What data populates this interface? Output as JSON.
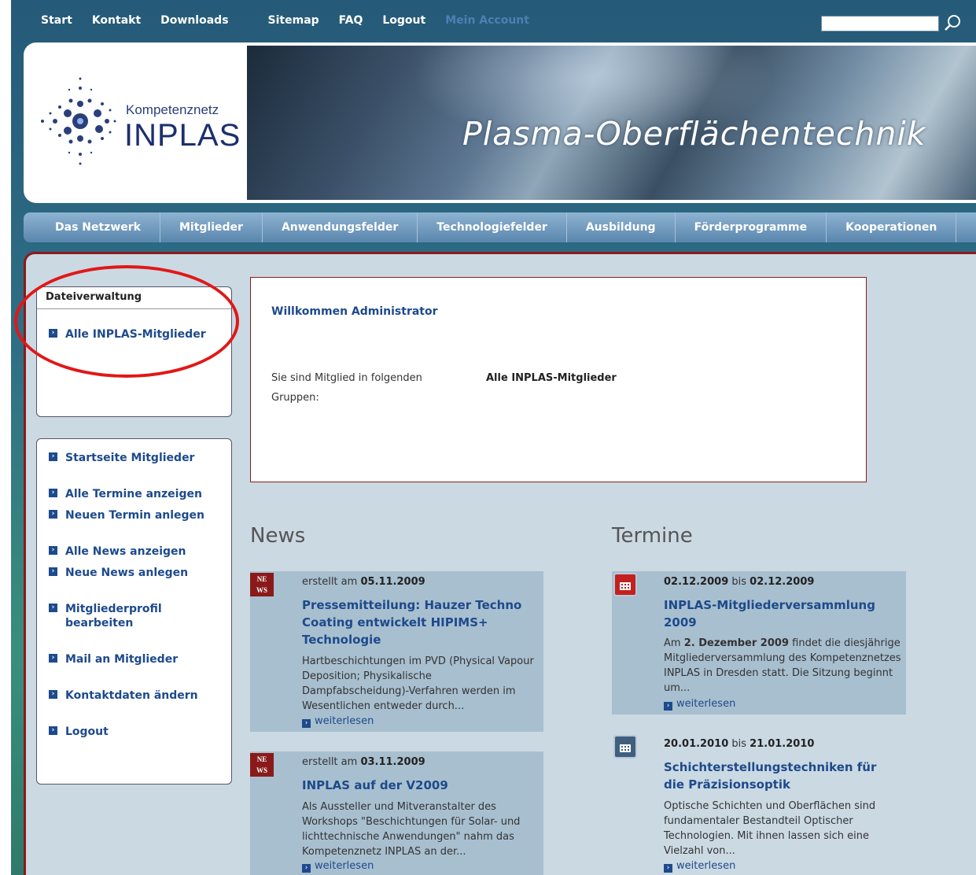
{
  "topnav": {
    "items": [
      "Start",
      "Kontakt",
      "Downloads",
      "Sitemap",
      "FAQ",
      "Logout",
      "Mein Account"
    ],
    "search_placeholder": ""
  },
  "header": {
    "logo_small": "Kompetenznetz",
    "logo_big": "INPLAS",
    "banner_title": "Plasma-Oberflächentechnik"
  },
  "mainnav": [
    "Das Netzwerk",
    "Mitglieder",
    "Anwendungsfelder",
    "Technologiefelder",
    "Ausbildung",
    "Förderprogramme",
    "Kooperationen"
  ],
  "sidebar": {
    "file_box_title": "Dateiverwaltung",
    "file_box_link": "Alle INPLAS-Mitglieder",
    "links": [
      "Startseite Mitglieder",
      "Alle Termine anzeigen",
      "Neuen Termin anlegen",
      "Alle News anzeigen",
      "Neue News anlegen",
      "Mitgliederprofil bearbeiten",
      "Mail an Mitglieder",
      "Kontaktdaten ändern",
      "Logout"
    ]
  },
  "welcome": {
    "title": "Willkommen Administrator",
    "label": "Sie sind Mitglied in folgenden Gruppen:",
    "value": "Alle INPLAS-Mitglieder"
  },
  "news": {
    "title": "News",
    "items": [
      {
        "meta_prefix": "erstellt am",
        "date": "05.11.2009",
        "title": "Pressemitteilung: Hauzer Techno Coating entwickelt HIPIMS+ Technologie",
        "body": "Hartbeschichtungen im PVD (Physical Vapour Deposition; Physikalische Dampfabscheidung)-Verfahren werden im Wesentlichen entweder durch...",
        "more": "weiterlesen"
      },
      {
        "meta_prefix": "erstellt am",
        "date": "03.11.2009",
        "title": "INPLAS auf der V2009",
        "body": "Als Aussteller und Mitveranstalter des Workshops \"Beschichtungen für Solar- und lichttechnische Anwendungen\" nahm das Kompetenznetz INPLAS an der...",
        "more": "weiterlesen"
      }
    ]
  },
  "termine": {
    "title": "Termine",
    "items": [
      {
        "start": "02.12.2009",
        "sep": "bis",
        "end": "02.12.2009",
        "title": "INPLAS-Mitgliederversammlung 2009",
        "body_prefix": "Am",
        "body_bold": "2. Dezember 2009",
        "body_rest": "findet die diesjährige Mitgliederversammlung des Kompetenznetzes INPLAS in Dresden statt. Die Sitzung beginnt um...",
        "more": "weiterlesen"
      },
      {
        "start": "20.01.2010",
        "sep": "bis",
        "end": "21.01.2010",
        "title": "Schichterstellungstechniken für die Präzisionsoptik",
        "body": "Optische Schichten und Oberflächen sind fundamentaler Bestandteil Optischer Technologien. Mit ihnen lassen sich eine Vielzahl von...",
        "more": "weiterlesen"
      }
    ]
  },
  "icons": {
    "news": "NEWS",
    "bullet": "arrow-right-icon",
    "search": "magnifier-icon",
    "calendar": "calendar-icon"
  },
  "colors": {
    "link": "#1d4a8c",
    "accent_red": "#8b1a1a",
    "highlight_circle": "#e01818"
  }
}
